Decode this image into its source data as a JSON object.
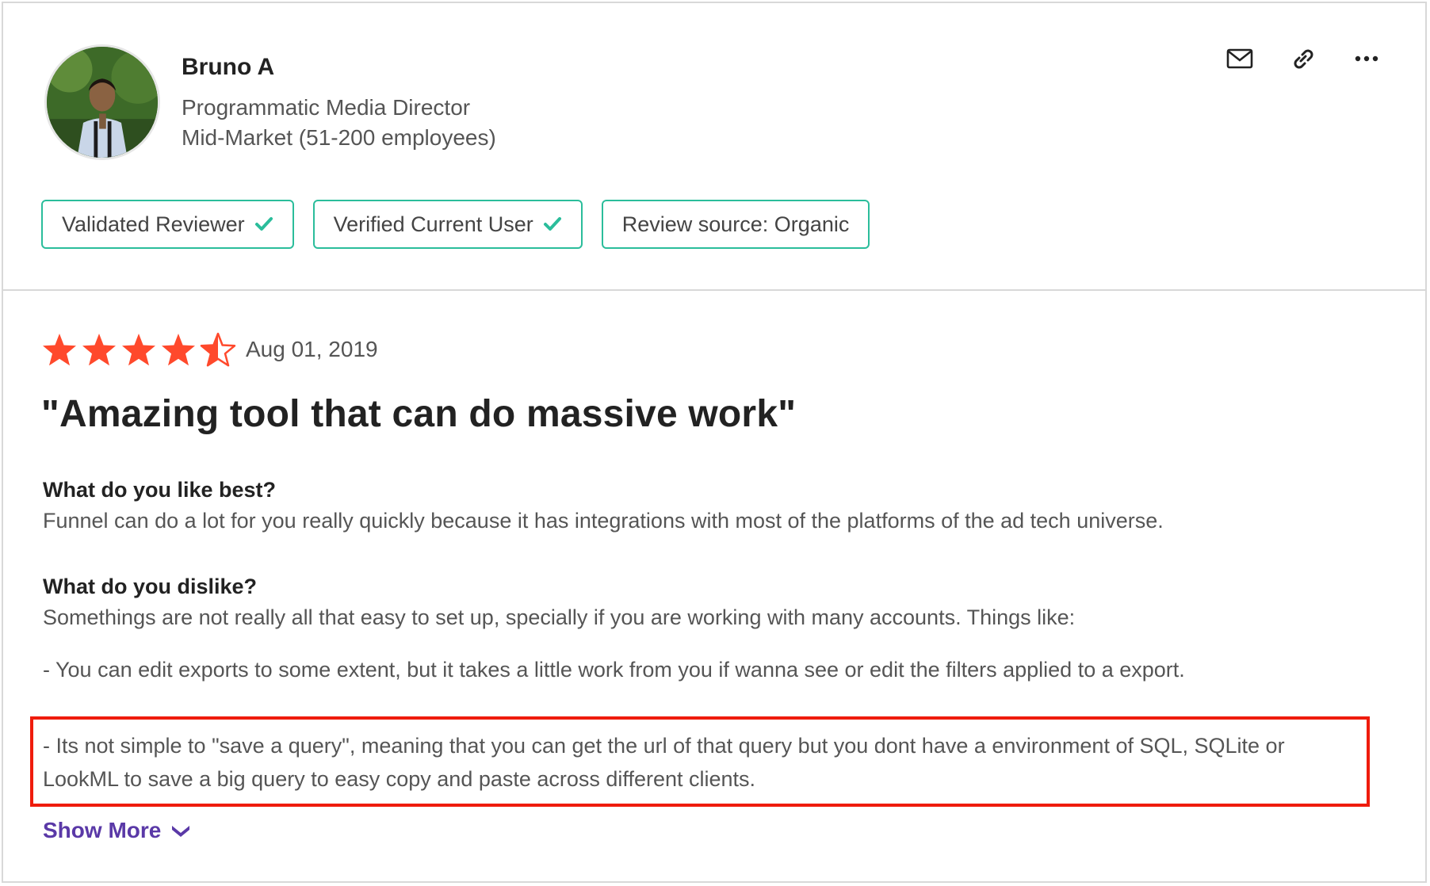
{
  "reviewer": {
    "name": "Bruno A",
    "job_title": "Programmatic Media Director",
    "company_size": "Mid-Market (51-200 employees)",
    "avatar_icon": "user-photo"
  },
  "header_actions": [
    {
      "icon": "envelope-icon"
    },
    {
      "icon": "link-icon"
    },
    {
      "icon": "more-dots-icon"
    }
  ],
  "badges": [
    {
      "label": "Validated Reviewer",
      "checked": true
    },
    {
      "label": "Verified Current User",
      "checked": true
    },
    {
      "label": "Review source: Organic",
      "checked": false
    }
  ],
  "review": {
    "rating": 4.5,
    "rating_max": 5,
    "star_color": "#ff492c",
    "date": "Aug 01, 2019",
    "title": "\"Amazing tool that can do massive work\"",
    "like_question": "What do you like best?",
    "like_answer": "Funnel can do a lot for you really quickly because it has integrations with most of the platforms of the ad tech universe.",
    "dislike_question": "What do you dislike?",
    "dislike_intro": "Somethings are not really all that easy to set up, specially if you are working with many accounts. Things like:",
    "dislike_point1": "- You can edit exports to some extent, but it takes a little work from you if wanna see or edit the filters applied to a export.",
    "dislike_point2_line1": "- Its not simple to \"save a query\", meaning that you can get the url of that query but you dont have a environment of SQL, SQLite or",
    "dislike_point2_line2": "LookML to save a big query to easy copy and paste across different clients."
  },
  "show_more": {
    "label": "Show More",
    "icon": "chevron-down-icon"
  },
  "colors": {
    "badge_border": "#2bbd9b",
    "highlight_border": "#ef1c0c",
    "link": "#5a39a7"
  }
}
